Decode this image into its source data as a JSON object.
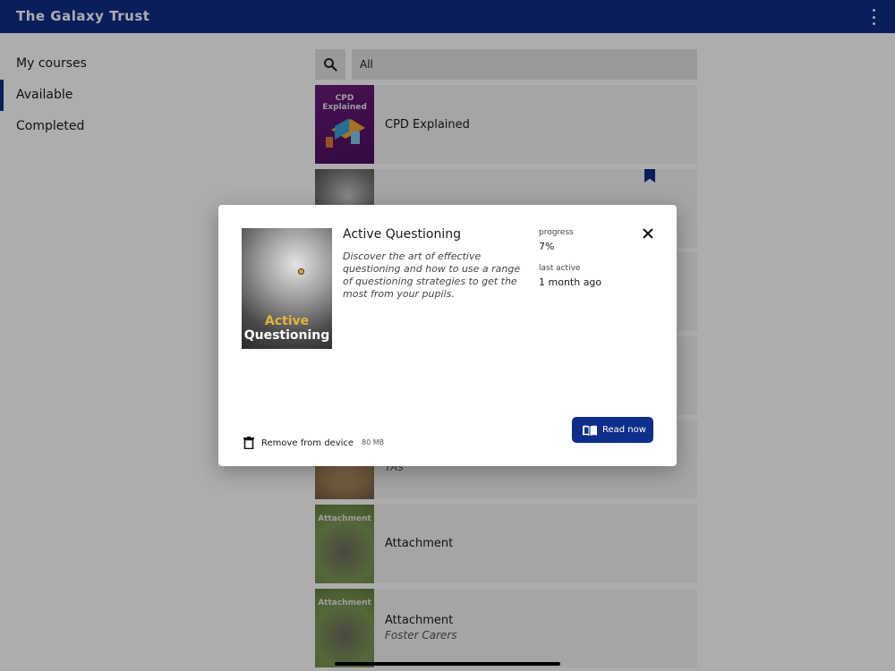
{
  "header": {
    "logo": "The Galaxy Trust",
    "menu_icon": "more-vertical-icon",
    "color": "#0f2d8a"
  },
  "sidebar": {
    "items": [
      {
        "label": "My courses",
        "active": false
      },
      {
        "label": "Available",
        "active": true
      },
      {
        "label": "Completed",
        "active": false
      }
    ]
  },
  "search": {
    "icon": "search-icon",
    "value": "All"
  },
  "courses": [
    {
      "title": "CPD Explained",
      "subtitle": "",
      "thumb_text": "CPD Explained",
      "bookmarked": false
    },
    {
      "title": "",
      "subtitle": "",
      "thumb_text": "",
      "bookmarked": true
    },
    {
      "title": "",
      "subtitle": "",
      "thumb_text": "",
      "bookmarked": false
    },
    {
      "title": "",
      "subtitle": "",
      "thumb_text": "",
      "bookmarked": false
    },
    {
      "title": "",
      "subtitle": "TAs",
      "thumb_text": "",
      "bookmarked": false
    },
    {
      "title": "Attachment",
      "subtitle": "",
      "thumb_text": "Attachment",
      "bookmarked": false
    },
    {
      "title": "Attachment",
      "subtitle": "Foster Carers",
      "thumb_text": "Attachment",
      "bookmarked": false
    }
  ],
  "dialog": {
    "title": "Active Questioning",
    "description": "Discover the art of effective questioning and how to use a range of questioning strategies to get the most from your pupils.",
    "cover_line1": "Active",
    "cover_line2": "Questioning",
    "progress_label": "progress",
    "progress_value": "7%",
    "last_active_label": "last active",
    "last_active_value": "1 month ago",
    "remove_label": "Remove from device",
    "size": "80 MB",
    "read_label": "Read now",
    "close_icon": "close-icon",
    "remove_icon": "trash-icon",
    "read_icon": "book-open-icon"
  }
}
